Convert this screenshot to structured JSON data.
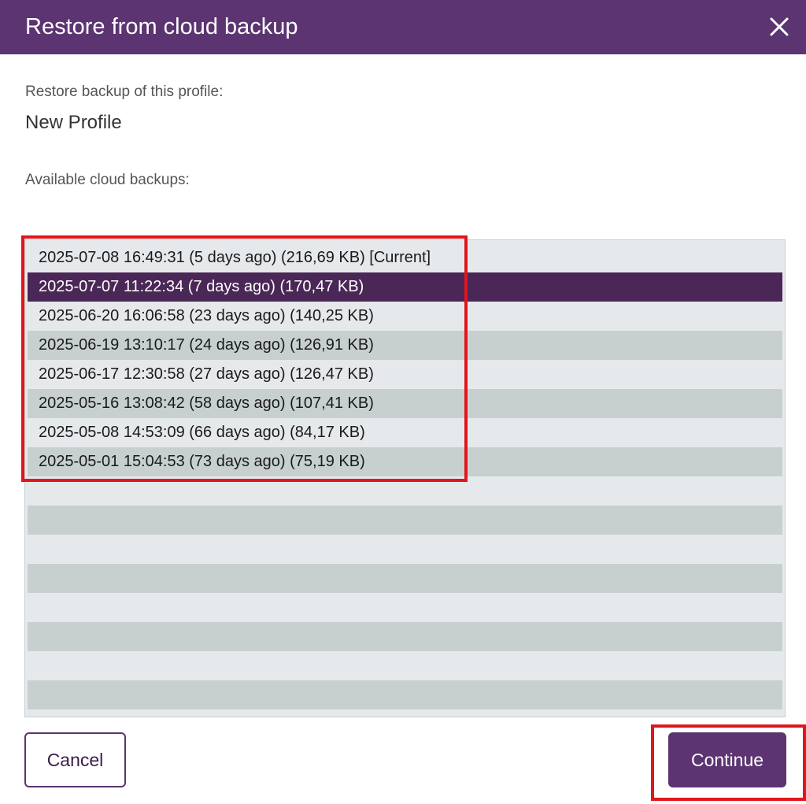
{
  "dialog": {
    "title": "Restore from cloud backup",
    "close_icon": "close-icon",
    "accent_color": "#5c3471",
    "selected_color": "#4a2756",
    "highlight_color": "#e0161c"
  },
  "profile": {
    "label": "Restore backup of this profile:",
    "name": "New Profile"
  },
  "backups": {
    "label": "Available cloud backups:",
    "selected_index": 1,
    "items": [
      {
        "text": "2025-07-08 16:49:31 (5 days ago) (216,69 KB) [Current]"
      },
      {
        "text": "2025-07-07 11:22:34 (7 days ago) (170,47 KB)"
      },
      {
        "text": "2025-06-20 16:06:58 (23 days ago) (140,25 KB)"
      },
      {
        "text": "2025-06-19 13:10:17 (24 days ago) (126,91 KB)"
      },
      {
        "text": "2025-06-17 12:30:58 (27 days ago) (126,47 KB)"
      },
      {
        "text": "2025-05-16 13:08:42 (58 days ago) (107,41 KB)"
      },
      {
        "text": "2025-05-08 14:53:09 (66 days ago) (84,17 KB)"
      },
      {
        "text": "2025-05-01 15:04:53 (73 days ago) (75,19 KB)"
      },
      {
        "text": ""
      },
      {
        "text": ""
      },
      {
        "text": ""
      },
      {
        "text": ""
      },
      {
        "text": ""
      },
      {
        "text": ""
      },
      {
        "text": ""
      },
      {
        "text": ""
      }
    ]
  },
  "buttons": {
    "cancel_label": "Cancel",
    "continue_label": "Continue"
  }
}
